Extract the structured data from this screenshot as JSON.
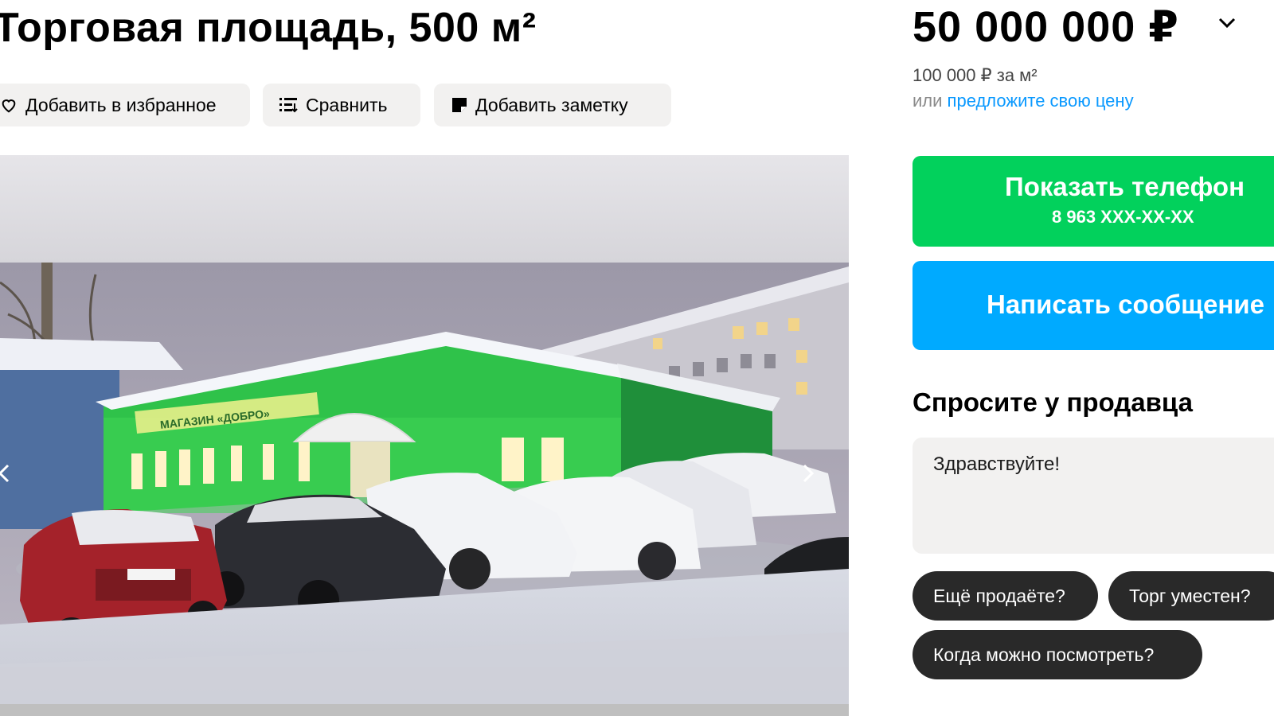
{
  "listing": {
    "title": "Торговая площадь, 500 м²"
  },
  "actions": {
    "favorite_label": "Добавить в избранное",
    "compare_label": "Сравнить",
    "note_label": "Добавить заметку"
  },
  "price": {
    "total": "50 000 000 ₽",
    "per_meter": "100 000 ₽ за м²",
    "offer_prefix": "или",
    "offer_link": "предложите свою цену"
  },
  "contact": {
    "phone_label": "Показать телефон",
    "phone_masked": "8 963 XXX-XX-XX",
    "message_label": "Написать сообщение"
  },
  "ask_seller": {
    "heading": "Спросите у продавца",
    "message_value": "Здравствуйте!",
    "quick_questions": [
      "Ещё продаёте?",
      "Торг уместен?",
      "Когда можно посмотреть?"
    ]
  },
  "photo": {
    "store_sign": "МАГАЗИН «ДОБРО»"
  },
  "colors": {
    "phone_button": "#02d15c",
    "message_button": "#00aaff",
    "link": "#0a99ff",
    "chip_bg": "#292929",
    "action_bg": "#f2f1f0"
  },
  "icons": {
    "favorite": "heart-icon",
    "compare": "compare-list-icon",
    "note": "note-icon",
    "price_toggle": "chevron-down-icon",
    "prev_photo": "chevron-left-icon",
    "next_photo": "chevron-right-icon"
  }
}
